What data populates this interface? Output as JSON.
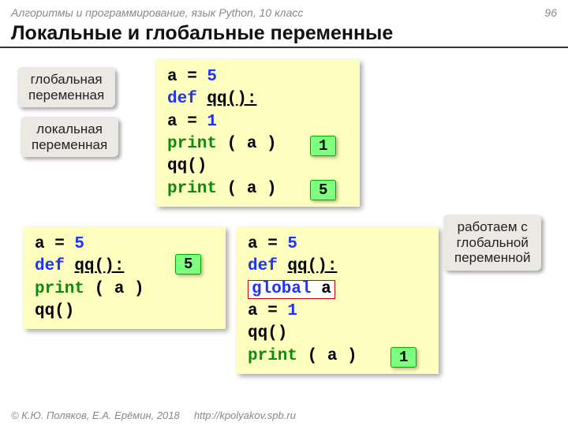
{
  "header": {
    "course": "Алгоритмы и программирование, язык Python, 10 класс",
    "page": "96"
  },
  "title": "Локальные и глобальные переменные",
  "tags": {
    "global_var": "глобальная\nпеременная",
    "local_var": "локальная\nпеременная",
    "note": "работаем с\nглобальной\nпеременной"
  },
  "code1": {
    "l1a": "a",
    "l1b": " = ",
    "l1c": "5",
    "l2a": "def",
    "l2b": " ",
    "l2c": "qq():",
    "l3a": "  a",
    "l3b": " = ",
    "l3c": "1",
    "l4a": "  ",
    "l4b": "print",
    "l4c": " ( a )",
    "l5": "qq()",
    "l6a": "print",
    "l6b": " ( a )"
  },
  "code2": {
    "l1a": "a",
    "l1b": " = ",
    "l1c": "5",
    "l2a": "def",
    "l2b": " ",
    "l2c": "qq():",
    "l3a": "  ",
    "l3b": "print",
    "l3c": " ( a )",
    "l4": "qq()"
  },
  "code3": {
    "l1a": "a",
    "l1b": " = ",
    "l1c": "5",
    "l2a": "def",
    "l2b": " ",
    "l2c": "qq():",
    "l3pre": "   ",
    "l3a": "global",
    "l3b": " a",
    "l4a": "  a",
    "l4b": " = ",
    "l4c": "1",
    "l5": "qq()",
    "l6a": "print",
    "l6b": " ( a )"
  },
  "badges": {
    "b1": "1",
    "b2": "5",
    "b3": "5",
    "b4": "1"
  },
  "footer": {
    "copy": "© К.Ю. Поляков, Е.А. Ерёмин, 2018",
    "url": "http://kpolyakov.spb.ru"
  }
}
